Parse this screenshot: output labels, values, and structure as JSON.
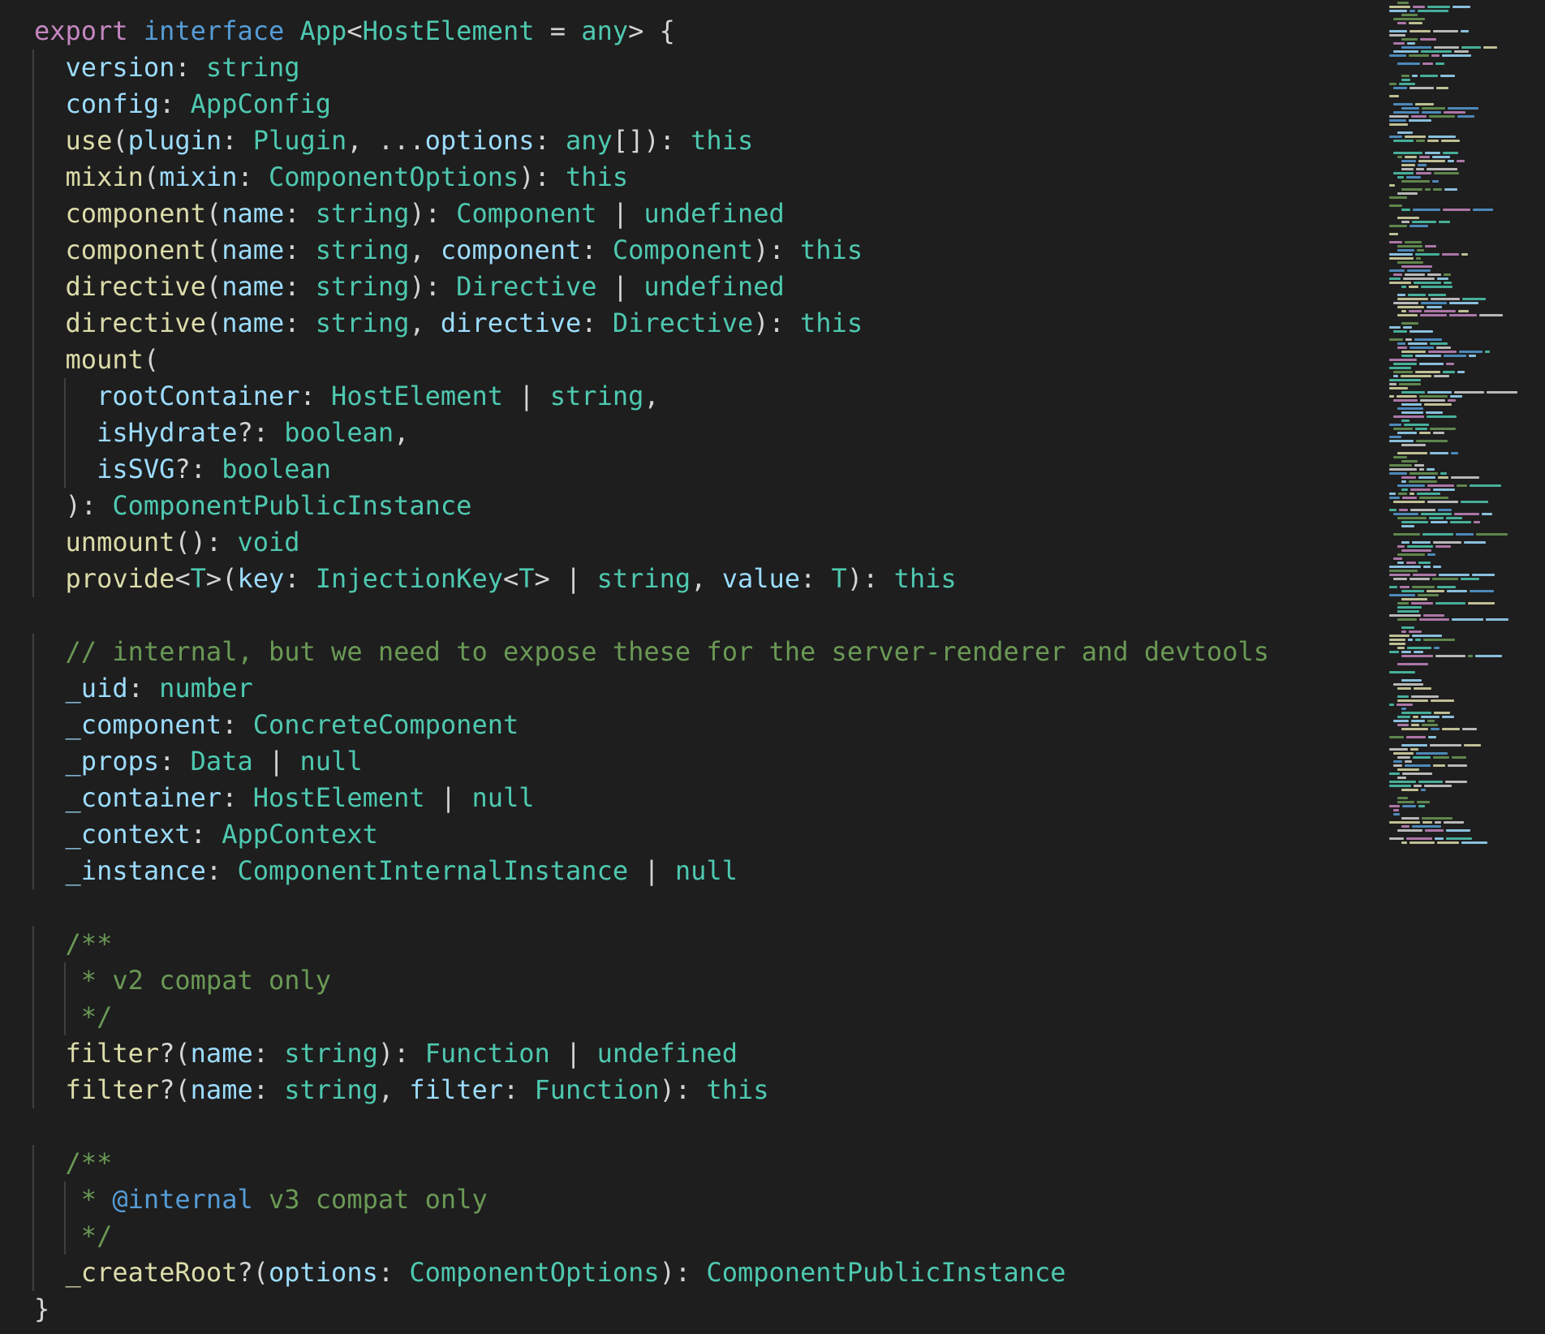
{
  "colors": {
    "background": "#1e1e1e",
    "keyword_export": "#c586c0",
    "keyword_interface": "#569cd6",
    "type": "#4ec9b0",
    "function": "#dcdcaa",
    "property": "#9cdcfe",
    "comment": "#6a9955",
    "jsdoc_tag": "#569cd6",
    "punctuation": "#d4d4d4"
  },
  "editor": {
    "lines": [
      {
        "indent": 0,
        "tokens": [
          [
            "export",
            "t-kw"
          ],
          [
            " ",
            "t-punct"
          ],
          [
            "interface",
            "t-kw2"
          ],
          [
            " ",
            "t-punct"
          ],
          [
            "App",
            "t-type"
          ],
          [
            "<",
            "t-punct"
          ],
          [
            "HostElement",
            "t-type"
          ],
          [
            " = ",
            "t-punct"
          ],
          [
            "any",
            "t-type"
          ],
          [
            "> {",
            "t-punct"
          ]
        ]
      },
      {
        "indent": 1,
        "tokens": [
          [
            "version",
            "t-prop"
          ],
          [
            ": ",
            "t-punct"
          ],
          [
            "string",
            "t-type"
          ]
        ]
      },
      {
        "indent": 1,
        "tokens": [
          [
            "config",
            "t-prop"
          ],
          [
            ": ",
            "t-punct"
          ],
          [
            "AppConfig",
            "t-type"
          ]
        ]
      },
      {
        "indent": 1,
        "tokens": [
          [
            "use",
            "t-fn"
          ],
          [
            "(",
            "t-punct"
          ],
          [
            "plugin",
            "t-prop"
          ],
          [
            ": ",
            "t-punct"
          ],
          [
            "Plugin",
            "t-type"
          ],
          [
            ", ...",
            "t-punct"
          ],
          [
            "options",
            "t-prop"
          ],
          [
            ": ",
            "t-punct"
          ],
          [
            "any",
            "t-type"
          ],
          [
            "[]): ",
            "t-punct"
          ],
          [
            "this",
            "t-type"
          ]
        ]
      },
      {
        "indent": 1,
        "tokens": [
          [
            "mixin",
            "t-fn"
          ],
          [
            "(",
            "t-punct"
          ],
          [
            "mixin",
            "t-prop"
          ],
          [
            ": ",
            "t-punct"
          ],
          [
            "ComponentOptions",
            "t-type"
          ],
          [
            "): ",
            "t-punct"
          ],
          [
            "this",
            "t-type"
          ]
        ]
      },
      {
        "indent": 1,
        "tokens": [
          [
            "component",
            "t-fn"
          ],
          [
            "(",
            "t-punct"
          ],
          [
            "name",
            "t-prop"
          ],
          [
            ": ",
            "t-punct"
          ],
          [
            "string",
            "t-type"
          ],
          [
            "): ",
            "t-punct"
          ],
          [
            "Component",
            "t-type"
          ],
          [
            " | ",
            "t-punct"
          ],
          [
            "undefined",
            "t-type"
          ]
        ]
      },
      {
        "indent": 1,
        "tokens": [
          [
            "component",
            "t-fn"
          ],
          [
            "(",
            "t-punct"
          ],
          [
            "name",
            "t-prop"
          ],
          [
            ": ",
            "t-punct"
          ],
          [
            "string",
            "t-type"
          ],
          [
            ", ",
            "t-punct"
          ],
          [
            "component",
            "t-prop"
          ],
          [
            ": ",
            "t-punct"
          ],
          [
            "Component",
            "t-type"
          ],
          [
            "): ",
            "t-punct"
          ],
          [
            "this",
            "t-type"
          ]
        ]
      },
      {
        "indent": 1,
        "tokens": [
          [
            "directive",
            "t-fn"
          ],
          [
            "(",
            "t-punct"
          ],
          [
            "name",
            "t-prop"
          ],
          [
            ": ",
            "t-punct"
          ],
          [
            "string",
            "t-type"
          ],
          [
            "): ",
            "t-punct"
          ],
          [
            "Directive",
            "t-type"
          ],
          [
            " | ",
            "t-punct"
          ],
          [
            "undefined",
            "t-type"
          ]
        ]
      },
      {
        "indent": 1,
        "tokens": [
          [
            "directive",
            "t-fn"
          ],
          [
            "(",
            "t-punct"
          ],
          [
            "name",
            "t-prop"
          ],
          [
            ": ",
            "t-punct"
          ],
          [
            "string",
            "t-type"
          ],
          [
            ", ",
            "t-punct"
          ],
          [
            "directive",
            "t-prop"
          ],
          [
            ": ",
            "t-punct"
          ],
          [
            "Directive",
            "t-type"
          ],
          [
            "): ",
            "t-punct"
          ],
          [
            "this",
            "t-type"
          ]
        ]
      },
      {
        "indent": 1,
        "tokens": [
          [
            "mount",
            "t-fn"
          ],
          [
            "(",
            "t-punct"
          ]
        ]
      },
      {
        "indent": 2,
        "tokens": [
          [
            "rootContainer",
            "t-prop"
          ],
          [
            ": ",
            "t-punct"
          ],
          [
            "HostElement",
            "t-type"
          ],
          [
            " | ",
            "t-punct"
          ],
          [
            "string",
            "t-type"
          ],
          [
            ",",
            "t-punct"
          ]
        ]
      },
      {
        "indent": 2,
        "tokens": [
          [
            "isHydrate",
            "t-prop"
          ],
          [
            "?: ",
            "t-punct"
          ],
          [
            "boolean",
            "t-type"
          ],
          [
            ",",
            "t-punct"
          ]
        ]
      },
      {
        "indent": 2,
        "tokens": [
          [
            "isSVG",
            "t-prop"
          ],
          [
            "?: ",
            "t-punct"
          ],
          [
            "boolean",
            "t-type"
          ]
        ]
      },
      {
        "indent": 1,
        "tokens": [
          [
            "): ",
            "t-punct"
          ],
          [
            "ComponentPublicInstance",
            "t-type"
          ]
        ]
      },
      {
        "indent": 1,
        "tokens": [
          [
            "unmount",
            "t-fn"
          ],
          [
            "(): ",
            "t-punct"
          ],
          [
            "void",
            "t-type"
          ]
        ]
      },
      {
        "indent": 1,
        "tokens": [
          [
            "provide",
            "t-fn"
          ],
          [
            "<",
            "t-punct"
          ],
          [
            "T",
            "t-type"
          ],
          [
            ">(",
            "t-punct"
          ],
          [
            "key",
            "t-prop"
          ],
          [
            ": ",
            "t-punct"
          ],
          [
            "InjectionKey",
            "t-type"
          ],
          [
            "<",
            "t-punct"
          ],
          [
            "T",
            "t-type"
          ],
          [
            "> | ",
            "t-punct"
          ],
          [
            "string",
            "t-type"
          ],
          [
            ", ",
            "t-punct"
          ],
          [
            "value",
            "t-prop"
          ],
          [
            ": ",
            "t-punct"
          ],
          [
            "T",
            "t-type"
          ],
          [
            "): ",
            "t-punct"
          ],
          [
            "this",
            "t-type"
          ]
        ]
      },
      {
        "indent": 0,
        "tokens": []
      },
      {
        "indent": 1,
        "tokens": [
          [
            "// internal, but we need to expose these for the server-renderer and devtools",
            "t-comment"
          ]
        ]
      },
      {
        "indent": 1,
        "tokens": [
          [
            "_uid",
            "t-prop"
          ],
          [
            ": ",
            "t-punct"
          ],
          [
            "number",
            "t-type"
          ]
        ]
      },
      {
        "indent": 1,
        "tokens": [
          [
            "_component",
            "t-prop"
          ],
          [
            ": ",
            "t-punct"
          ],
          [
            "ConcreteComponent",
            "t-type"
          ]
        ]
      },
      {
        "indent": 1,
        "tokens": [
          [
            "_props",
            "t-prop"
          ],
          [
            ": ",
            "t-punct"
          ],
          [
            "Data",
            "t-type"
          ],
          [
            " | ",
            "t-punct"
          ],
          [
            "null",
            "t-type"
          ]
        ]
      },
      {
        "indent": 1,
        "tokens": [
          [
            "_container",
            "t-prop"
          ],
          [
            ": ",
            "t-punct"
          ],
          [
            "HostElement",
            "t-type"
          ],
          [
            " | ",
            "t-punct"
          ],
          [
            "null",
            "t-type"
          ]
        ]
      },
      {
        "indent": 1,
        "tokens": [
          [
            "_context",
            "t-prop"
          ],
          [
            ": ",
            "t-punct"
          ],
          [
            "AppContext",
            "t-type"
          ]
        ]
      },
      {
        "indent": 1,
        "tokens": [
          [
            "_instance",
            "t-prop"
          ],
          [
            ": ",
            "t-punct"
          ],
          [
            "ComponentInternalInstance",
            "t-type"
          ],
          [
            " | ",
            "t-punct"
          ],
          [
            "null",
            "t-type"
          ]
        ]
      },
      {
        "indent": 0,
        "tokens": []
      },
      {
        "indent": 1,
        "tokens": [
          [
            "/**",
            "t-comment"
          ]
        ]
      },
      {
        "indent": 1,
        "guide2": true,
        "tokens": [
          [
            " * v2 compat only",
            "t-comment"
          ]
        ]
      },
      {
        "indent": 1,
        "guide2": true,
        "tokens": [
          [
            " */",
            "t-comment"
          ]
        ]
      },
      {
        "indent": 1,
        "tokens": [
          [
            "filter",
            "t-fn"
          ],
          [
            "?(",
            "t-punct"
          ],
          [
            "name",
            "t-prop"
          ],
          [
            ": ",
            "t-punct"
          ],
          [
            "string",
            "t-type"
          ],
          [
            "): ",
            "t-punct"
          ],
          [
            "Function",
            "t-type"
          ],
          [
            " | ",
            "t-punct"
          ],
          [
            "undefined",
            "t-type"
          ]
        ]
      },
      {
        "indent": 1,
        "tokens": [
          [
            "filter",
            "t-fn"
          ],
          [
            "?(",
            "t-punct"
          ],
          [
            "name",
            "t-prop"
          ],
          [
            ": ",
            "t-punct"
          ],
          [
            "string",
            "t-type"
          ],
          [
            ", ",
            "t-punct"
          ],
          [
            "filter",
            "t-prop"
          ],
          [
            ": ",
            "t-punct"
          ],
          [
            "Function",
            "t-type"
          ],
          [
            "): ",
            "t-punct"
          ],
          [
            "this",
            "t-type"
          ]
        ]
      },
      {
        "indent": 0,
        "tokens": []
      },
      {
        "indent": 1,
        "tokens": [
          [
            "/**",
            "t-comment"
          ]
        ]
      },
      {
        "indent": 1,
        "guide2": true,
        "tokens": [
          [
            " * ",
            "t-comment"
          ],
          [
            "@internal",
            "t-tag"
          ],
          [
            " v3 compat only",
            "t-comment"
          ]
        ]
      },
      {
        "indent": 1,
        "guide2": true,
        "tokens": [
          [
            " */",
            "t-comment"
          ]
        ]
      },
      {
        "indent": 1,
        "tokens": [
          [
            "_createRoot",
            "t-fn"
          ],
          [
            "?(",
            "t-punct"
          ],
          [
            "options",
            "t-prop"
          ],
          [
            ": ",
            "t-punct"
          ],
          [
            "ComponentOptions",
            "t-type"
          ],
          [
            "): ",
            "t-punct"
          ],
          [
            "ComponentPublicInstance",
            "t-type"
          ]
        ]
      },
      {
        "indent": 0,
        "tokens": [
          [
            "}",
            "t-punct"
          ]
        ]
      }
    ]
  }
}
